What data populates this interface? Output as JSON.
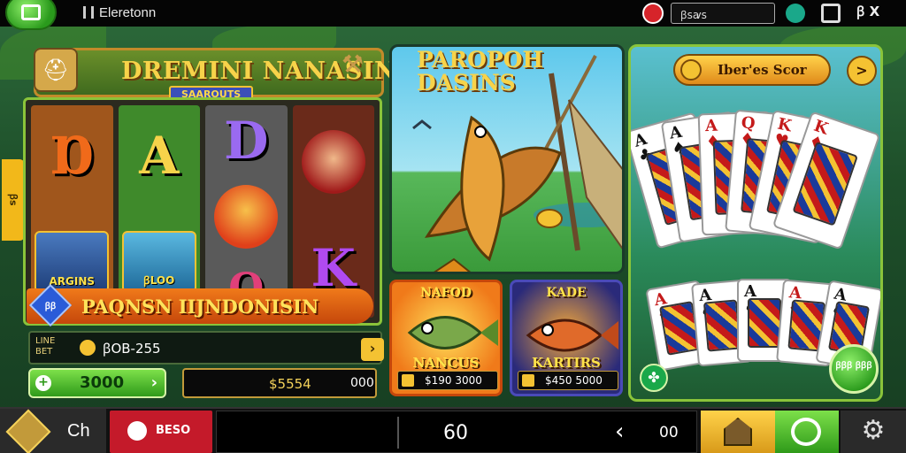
{
  "top_bar": {
    "title": "Eleretonn",
    "field_value": "ꞵꜱꜹꜱ",
    "close_label": "ꞵ X"
  },
  "slot_game": {
    "title": "DREMINI NANASIN",
    "subtitle": "SAAROUTS",
    "side_tab": "ꞵꜱ",
    "reel_symbols": {
      "r1_top": "Ɒ",
      "r1_card": "ARGINS",
      "r2_top": "A",
      "r2_card": "ꞵLOO",
      "r3_top": "D",
      "r3_bottom": "Q",
      "r4_bottom": "K"
    },
    "jackpot_label": "PAQNSN IIJNDONISIN",
    "gem_label": "ꞵꞵ",
    "bet_label": "LINE BET",
    "bet_value": "ꞵOB-255",
    "spin_value": "3000",
    "balance_amount": "$5554",
    "balance_extra": "000"
  },
  "fish_game": {
    "title_line1": "PAROPOH",
    "title_line2": "DASINS"
  },
  "tiles": [
    {
      "title_top": "NAFOD",
      "title_bottom": "NANCUS",
      "foot_value": "$190 3000"
    },
    {
      "title_top": "KADE",
      "title_bottom": "KARTIRS",
      "foot_value": "$450 5000"
    }
  ],
  "cards_game": {
    "header_label": "Iber'es Scor",
    "next_label": ">",
    "ok_label": "ꞵꞵꞵ ꞵꞵꞵ",
    "clover_label": "✤",
    "cards_top": [
      {
        "rank": "A",
        "suit": "♣",
        "red": false
      },
      {
        "rank": "A",
        "suit": "♠",
        "red": false
      },
      {
        "rank": "A",
        "suit": "♦",
        "red": true
      },
      {
        "rank": "Q",
        "suit": "♦",
        "red": true
      },
      {
        "rank": "K",
        "suit": "♥",
        "red": true
      },
      {
        "rank": "K",
        "suit": "♦",
        "red": true
      }
    ],
    "cards_bottom": [
      {
        "rank": "A",
        "suit": "♦",
        "red": true
      },
      {
        "rank": "A",
        "suit": "♠",
        "red": false
      },
      {
        "rank": "A",
        "suit": "♠",
        "red": false
      },
      {
        "rank": "A",
        "suit": "♦",
        "red": true
      },
      {
        "rank": "A",
        "suit": "♠",
        "red": false
      }
    ]
  },
  "bottom_bar": {
    "home_label": "Ch",
    "red_button_label": "BESO",
    "center_value": "60",
    "right_value": "00",
    "settings_icon": "⚙"
  },
  "colors": {
    "accent_gold": "#f4c232",
    "accent_green": "#2f9a1a",
    "accent_red": "#c41a2a",
    "background": "#1e4f2a"
  }
}
